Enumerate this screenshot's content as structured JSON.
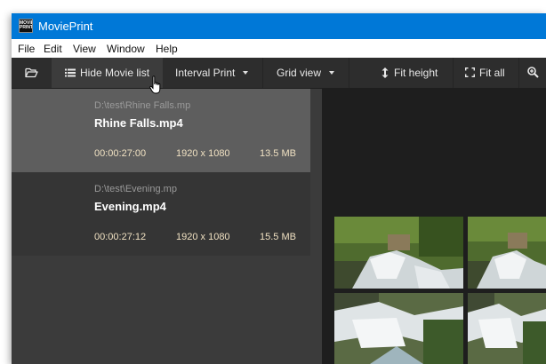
{
  "window": {
    "title": "MoviePrint",
    "icon_text": "MOVIE PRINT"
  },
  "menu": {
    "items": [
      "File",
      "Edit",
      "View",
      "Window",
      "Help"
    ]
  },
  "toolbar": {
    "open_icon": "folder-open-icon",
    "hide_movie_list": "Hide Movie list",
    "interval_print": "Interval Print",
    "grid_view": "Grid view",
    "fit_height": "Fit height",
    "fit_all": "Fit all"
  },
  "movies": [
    {
      "path": "D:\\test\\Rhine Falls.mp",
      "name": "Rhine Falls.mp4",
      "duration": "00:00:27:00",
      "resolution": "1920 x 1080",
      "size": "13.5 MB",
      "selected": true
    },
    {
      "path": "D:\\test\\Evening.mp",
      "name": "Evening.mp4",
      "duration": "00:00:27:12",
      "resolution": "1920 x 1080",
      "size": "15.5 MB",
      "selected": false
    }
  ],
  "colors": {
    "titlebar": "#0078d7",
    "toolbar": "#2d2d2d",
    "sidebar": "#3b3b3b",
    "selected_item": "#5e5e5e",
    "viewer": "#1e1e1e",
    "meta_text": "#f0e1c2"
  }
}
